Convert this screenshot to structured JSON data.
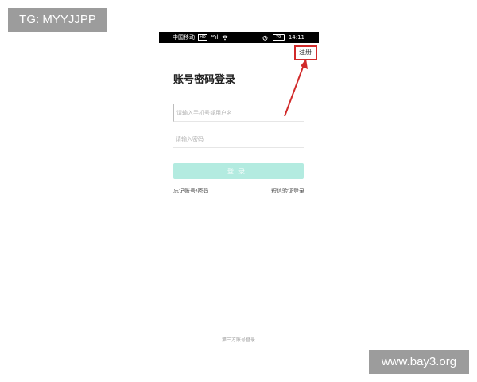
{
  "watermarks": {
    "top_left": "TG: MYYJJPP",
    "bottom_right": "www.bay3.org"
  },
  "status_bar": {
    "carrier": "中国移动",
    "carrier_badge": "HD",
    "signal": "⁴⁶ıl",
    "wifi_icon": "wifi-icon",
    "battery": "79",
    "time": "14:11"
  },
  "header": {
    "register_label": "注册"
  },
  "login": {
    "title": "账号密码登录",
    "phone_placeholder": "请输入手机号或用户名",
    "password_placeholder": "请输入密码",
    "submit_label": "登录",
    "forgot_label": "忘记账号/密码",
    "sms_label": "短信验证登录"
  },
  "footer": {
    "third_party_label": "第三方账号登录"
  },
  "colors": {
    "accent": "#b3ebe0",
    "annotation": "#d12a2a",
    "watermark_bg": "#9c9c9c"
  }
}
